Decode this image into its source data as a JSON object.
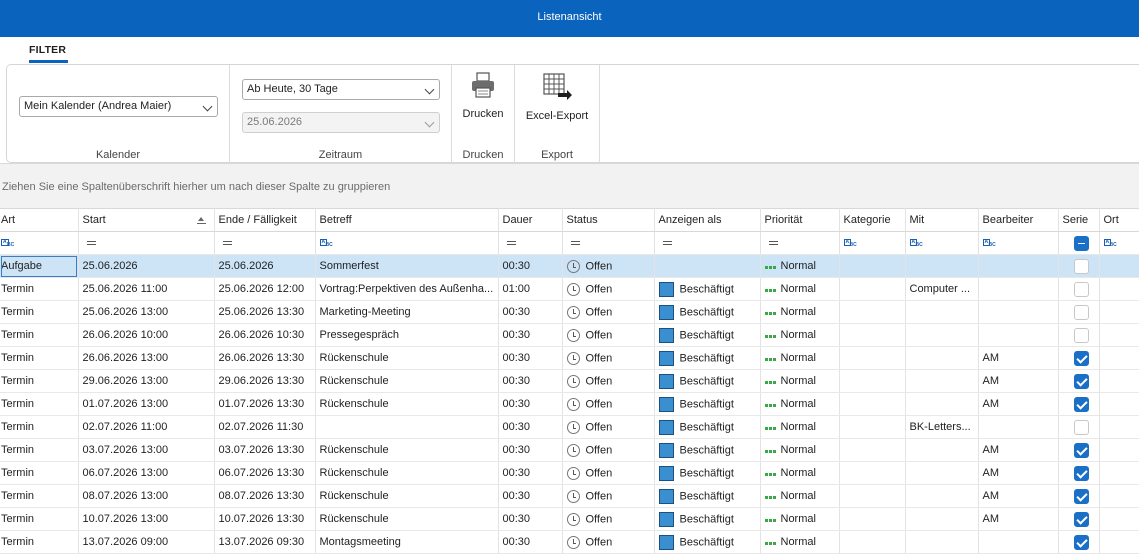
{
  "window": {
    "title": "Listenansicht"
  },
  "ribbon": {
    "tab": "FILTER",
    "calendar": {
      "value": "Mein Kalender (Andrea Maier)",
      "group_label": "Kalender"
    },
    "range": {
      "preset": "Ab Heute, 30 Tage",
      "date": "25.06.2026",
      "group_label": "Zeitraum"
    },
    "print": {
      "label": "Drucken",
      "group_label": "Drucken"
    },
    "export": {
      "label": "Excel-Export",
      "group_label": "Export"
    }
  },
  "group_hint": "Ziehen Sie eine Spaltenüberschrift hierher um nach dieser Spalte zu gruppieren",
  "columns": [
    "Art",
    "Start",
    "Ende / Fälligkeit",
    "Betreff",
    "Dauer",
    "Status",
    "Anzeigen als",
    "Priorität",
    "Kategorie",
    "Mit",
    "Bearbeiter",
    "Serie",
    "Ort"
  ],
  "rows": [
    {
      "art": "Aufgabe",
      "start": "25.06.2026",
      "ende": "25.06.2026",
      "betreff": "Sommerfest",
      "dauer": "00:30",
      "status": "Offen",
      "anzeigen": "",
      "prio": "Normal",
      "kategorie": "",
      "mit": "",
      "bearbeiter": "",
      "serie": false
    },
    {
      "art": "Termin",
      "start": "25.06.2026 11:00",
      "ende": "25.06.2026 12:00",
      "betreff": "Vortrag:Perpektiven des Außenha...",
      "dauer": "01:00",
      "status": "Offen",
      "anzeigen": "Beschäftigt",
      "prio": "Normal",
      "kategorie": "",
      "mit": "Computer ...",
      "bearbeiter": "",
      "serie": false
    },
    {
      "art": "Termin",
      "start": "25.06.2026 13:00",
      "ende": "25.06.2026 13:30",
      "betreff": "Marketing-Meeting",
      "dauer": "00:30",
      "status": "Offen",
      "anzeigen": "Beschäftigt",
      "prio": "Normal",
      "kategorie": "",
      "mit": "",
      "bearbeiter": "",
      "serie": false
    },
    {
      "art": "Termin",
      "start": "26.06.2026 10:00",
      "ende": "26.06.2026 10:30",
      "betreff": "Pressegespräch",
      "dauer": "00:30",
      "status": "Offen",
      "anzeigen": "Beschäftigt",
      "prio": "Normal",
      "kategorie": "",
      "mit": "",
      "bearbeiter": "",
      "serie": false
    },
    {
      "art": "Termin",
      "start": "26.06.2026 13:00",
      "ende": "26.06.2026 13:30",
      "betreff": "Rückenschule",
      "dauer": "00:30",
      "status": "Offen",
      "anzeigen": "Beschäftigt",
      "prio": "Normal",
      "kategorie": "",
      "mit": "",
      "bearbeiter": "AM",
      "serie": true
    },
    {
      "art": "Termin",
      "start": "29.06.2026 13:00",
      "ende": "29.06.2026 13:30",
      "betreff": "Rückenschule",
      "dauer": "00:30",
      "status": "Offen",
      "anzeigen": "Beschäftigt",
      "prio": "Normal",
      "kategorie": "",
      "mit": "",
      "bearbeiter": "AM",
      "serie": true
    },
    {
      "art": "Termin",
      "start": "01.07.2026 13:00",
      "ende": "01.07.2026 13:30",
      "betreff": "Rückenschule",
      "dauer": "00:30",
      "status": "Offen",
      "anzeigen": "Beschäftigt",
      "prio": "Normal",
      "kategorie": "",
      "mit": "",
      "bearbeiter": "AM",
      "serie": true
    },
    {
      "art": "Termin",
      "start": "02.07.2026 11:00",
      "ende": "02.07.2026 11:30",
      "betreff": "",
      "dauer": "00:30",
      "status": "Offen",
      "anzeigen": "Beschäftigt",
      "prio": "Normal",
      "kategorie": "",
      "mit": "BK-Letters...",
      "bearbeiter": "",
      "serie": false
    },
    {
      "art": "Termin",
      "start": "03.07.2026 13:00",
      "ende": "03.07.2026 13:30",
      "betreff": "Rückenschule",
      "dauer": "00:30",
      "status": "Offen",
      "anzeigen": "Beschäftigt",
      "prio": "Normal",
      "kategorie": "",
      "mit": "",
      "bearbeiter": "AM",
      "serie": true
    },
    {
      "art": "Termin",
      "start": "06.07.2026 13:00",
      "ende": "06.07.2026 13:30",
      "betreff": "Rückenschule",
      "dauer": "00:30",
      "status": "Offen",
      "anzeigen": "Beschäftigt",
      "prio": "Normal",
      "kategorie": "",
      "mit": "",
      "bearbeiter": "AM",
      "serie": true
    },
    {
      "art": "Termin",
      "start": "08.07.2026 13:00",
      "ende": "08.07.2026 13:30",
      "betreff": "Rückenschule",
      "dauer": "00:30",
      "status": "Offen",
      "anzeigen": "Beschäftigt",
      "prio": "Normal",
      "kategorie": "",
      "mit": "",
      "bearbeiter": "AM",
      "serie": true
    },
    {
      "art": "Termin",
      "start": "10.07.2026 13:00",
      "ende": "10.07.2026 13:30",
      "betreff": "Rückenschule",
      "dauer": "00:30",
      "status": "Offen",
      "anzeigen": "Beschäftigt",
      "prio": "Normal",
      "kategorie": "",
      "mit": "",
      "bearbeiter": "AM",
      "serie": true
    },
    {
      "art": "Termin",
      "start": "13.07.2026 09:00",
      "ende": "13.07.2026 09:30",
      "betreff": "Montagsmeeting",
      "dauer": "00:30",
      "status": "Offen",
      "anzeigen": "Beschäftigt",
      "prio": "Normal",
      "kategorie": "",
      "mit": "",
      "bearbeiter": "",
      "serie": true
    }
  ],
  "colors": {
    "titlebar": "#0a64bd",
    "selected_row": "#cde4f7",
    "checkbox_on": "#1a6fc7",
    "priority_dots": "#3aa845",
    "busy_swatch": "#3a8fd0"
  },
  "icons": {
    "status": "clock-icon",
    "print": "printer-icon",
    "export": "excel-export-icon",
    "sort": "sort-ascending-icon",
    "text_filter": "abc-filter-icon",
    "equals_filter": "equals-filter-icon"
  }
}
